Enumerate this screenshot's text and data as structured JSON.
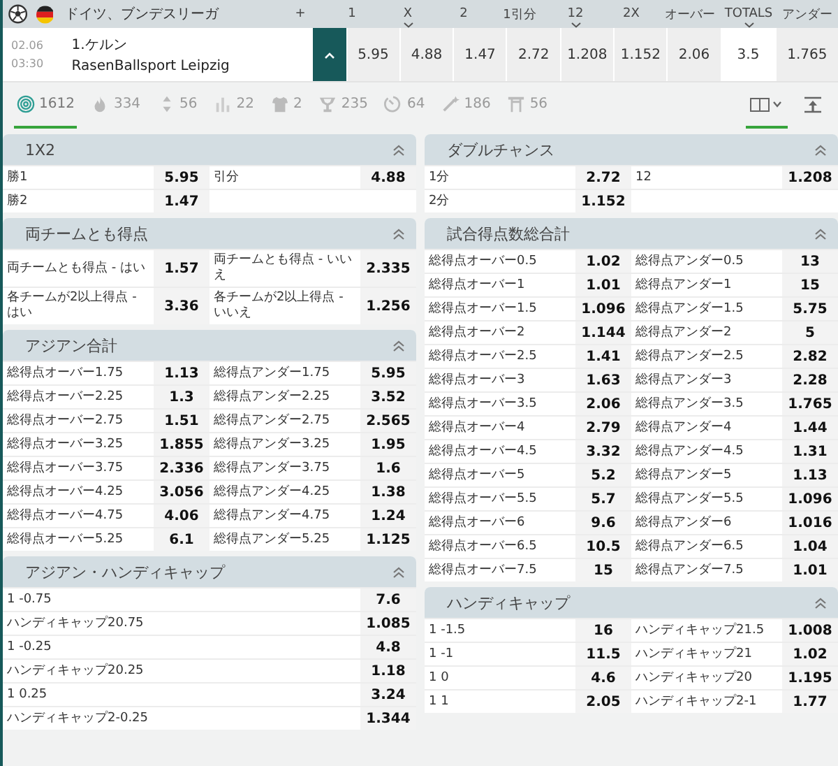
{
  "league": {
    "name": "ドイツ、ブンデスリーガ",
    "columns": [
      {
        "label": "+",
        "dropdown": false
      },
      {
        "label": "1",
        "dropdown": false
      },
      {
        "label": "X",
        "dropdown": true
      },
      {
        "label": "2",
        "dropdown": false
      },
      {
        "label": "1引分",
        "dropdown": false
      },
      {
        "label": "12",
        "dropdown": true
      },
      {
        "label": "2X",
        "dropdown": false
      },
      {
        "label": "オーバー",
        "dropdown": false
      },
      {
        "label": "TOTALS",
        "dropdown": true
      },
      {
        "label": "アンダー",
        "dropdown": false
      }
    ]
  },
  "match": {
    "date": "02.06",
    "time": "03:30",
    "home": "1.ケルン",
    "away": "RasenBallsport Leipzig",
    "expanded": true,
    "odds": [
      {
        "value": "5.95",
        "kind": "odd"
      },
      {
        "value": "4.88",
        "kind": "odd"
      },
      {
        "value": "1.47",
        "kind": "odd"
      },
      {
        "value": "2.72",
        "kind": "odd"
      },
      {
        "value": "1.208",
        "kind": "odd"
      },
      {
        "value": "1.152",
        "kind": "odd"
      },
      {
        "value": "2.06",
        "kind": "odd"
      },
      {
        "value": "3.5",
        "kind": "line"
      },
      {
        "value": "1.765",
        "kind": "odd"
      }
    ]
  },
  "filters": [
    {
      "kind": "all",
      "count": "1612",
      "selected": true
    },
    {
      "kind": "fire",
      "count": "334",
      "selected": false
    },
    {
      "kind": "updown",
      "count": "56",
      "selected": false
    },
    {
      "kind": "bars",
      "count": "22",
      "selected": false
    },
    {
      "kind": "shirt",
      "count": "2",
      "selected": false
    },
    {
      "kind": "trophy",
      "count": "235",
      "selected": false
    },
    {
      "kind": "timer",
      "count": "64",
      "selected": false
    },
    {
      "kind": "wand",
      "count": "186",
      "selected": false
    },
    {
      "kind": "gate",
      "count": "56",
      "selected": false
    }
  ],
  "view_buttons": [
    {
      "kind": "columns",
      "selected": true
    },
    {
      "kind": "collapse",
      "selected": false
    }
  ],
  "columns": [
    [
      {
        "title": "1X2",
        "expanded": true,
        "kind": "pairs",
        "rows": [
          [
            {
              "label": "勝1",
              "odd": "5.95"
            },
            {
              "label": "引分",
              "odd": "4.88"
            }
          ],
          [
            {
              "label": "勝2",
              "odd": "1.47"
            }
          ]
        ]
      },
      {
        "title": "両チームとも得点",
        "expanded": true,
        "kind": "pairs",
        "rows": [
          [
            {
              "label": "両チームとも得点 - はい",
              "odd": "1.57"
            },
            {
              "label": "両チームとも得点 - いいえ",
              "odd": "2.335"
            }
          ],
          [
            {
              "label": "各チームが2以上得点 - はい",
              "odd": "3.36"
            },
            {
              "label": "各チームが2以上得点 - いいえ",
              "odd": "1.256"
            }
          ]
        ]
      },
      {
        "title": "アジアン合計",
        "expanded": true,
        "kind": "pairs",
        "rows": [
          [
            {
              "label": "総得点オーバー1.75",
              "odd": "1.13"
            },
            {
              "label": "総得点アンダー1.75",
              "odd": "5.95"
            }
          ],
          [
            {
              "label": "総得点オーバー2.25",
              "odd": "1.3"
            },
            {
              "label": "総得点アンダー2.25",
              "odd": "3.52"
            }
          ],
          [
            {
              "label": "総得点オーバー2.75",
              "odd": "1.51"
            },
            {
              "label": "総得点アンダー2.75",
              "odd": "2.565"
            }
          ],
          [
            {
              "label": "総得点オーバー3.25",
              "odd": "1.855"
            },
            {
              "label": "総得点アンダー3.25",
              "odd": "1.95"
            }
          ],
          [
            {
              "label": "総得点オーバー3.75",
              "odd": "2.336"
            },
            {
              "label": "総得点アンダー3.75",
              "odd": "1.6"
            }
          ],
          [
            {
              "label": "総得点オーバー4.25",
              "odd": "3.056"
            },
            {
              "label": "総得点アンダー4.25",
              "odd": "1.38"
            }
          ],
          [
            {
              "label": "総得点オーバー4.75",
              "odd": "4.06"
            },
            {
              "label": "総得点アンダー4.75",
              "odd": "1.24"
            }
          ],
          [
            {
              "label": "総得点オーバー5.25",
              "odd": "6.1"
            },
            {
              "label": "総得点アンダー5.25",
              "odd": "1.125"
            }
          ]
        ]
      },
      {
        "title": "アジアン・ハンディキャップ",
        "expanded": true,
        "kind": "single",
        "rows": [
          [
            {
              "label": "1 -0.75",
              "odd": "7.6"
            }
          ],
          [
            {
              "label": "ハンディキャップ20.75",
              "odd": "1.085"
            }
          ],
          [
            {
              "label": "1 -0.25",
              "odd": "4.8"
            }
          ],
          [
            {
              "label": "ハンディキャップ20.25",
              "odd": "1.18"
            }
          ],
          [
            {
              "label": "1 0.25",
              "odd": "3.24"
            }
          ],
          [
            {
              "label": "ハンディキャップ2-0.25",
              "odd": "1.344"
            }
          ]
        ]
      }
    ],
    [
      {
        "title": "ダブルチャンス",
        "expanded": true,
        "kind": "pairs",
        "rows": [
          [
            {
              "label": "1分",
              "odd": "2.72"
            },
            {
              "label": "12",
              "odd": "1.208"
            }
          ],
          [
            {
              "label": "2分",
              "odd": "1.152"
            }
          ]
        ]
      },
      {
        "title": "試合得点数総合計",
        "expanded": true,
        "kind": "pairs",
        "rows": [
          [
            {
              "label": "総得点オーバー0.5",
              "odd": "1.02"
            },
            {
              "label": "総得点アンダー0.5",
              "odd": "13"
            }
          ],
          [
            {
              "label": "総得点オーバー1",
              "odd": "1.01"
            },
            {
              "label": "総得点アンダー1",
              "odd": "15"
            }
          ],
          [
            {
              "label": "総得点オーバー1.5",
              "odd": "1.096"
            },
            {
              "label": "総得点アンダー1.5",
              "odd": "5.75"
            }
          ],
          [
            {
              "label": "総得点オーバー2",
              "odd": "1.144"
            },
            {
              "label": "総得点アンダー2",
              "odd": "5"
            }
          ],
          [
            {
              "label": "総得点オーバー2.5",
              "odd": "1.41"
            },
            {
              "label": "総得点アンダー2.5",
              "odd": "2.82"
            }
          ],
          [
            {
              "label": "総得点オーバー3",
              "odd": "1.63"
            },
            {
              "label": "総得点アンダー3",
              "odd": "2.28"
            }
          ],
          [
            {
              "label": "総得点オーバー3.5",
              "odd": "2.06"
            },
            {
              "label": "総得点アンダー3.5",
              "odd": "1.765"
            }
          ],
          [
            {
              "label": "総得点オーバー4",
              "odd": "2.79"
            },
            {
              "label": "総得点アンダー4",
              "odd": "1.44"
            }
          ],
          [
            {
              "label": "総得点オーバー4.5",
              "odd": "3.32"
            },
            {
              "label": "総得点アンダー4.5",
              "odd": "1.31"
            }
          ],
          [
            {
              "label": "総得点オーバー5",
              "odd": "5.2"
            },
            {
              "label": "総得点アンダー5",
              "odd": "1.13"
            }
          ],
          [
            {
              "label": "総得点オーバー5.5",
              "odd": "5.7"
            },
            {
              "label": "総得点アンダー5.5",
              "odd": "1.096"
            }
          ],
          [
            {
              "label": "総得点オーバー6",
              "odd": "9.6"
            },
            {
              "label": "総得点アンダー6",
              "odd": "1.016"
            }
          ],
          [
            {
              "label": "総得点オーバー6.5",
              "odd": "10.5"
            },
            {
              "label": "総得点アンダー6.5",
              "odd": "1.04"
            }
          ],
          [
            {
              "label": "総得点オーバー7.5",
              "odd": "15"
            },
            {
              "label": "総得点アンダー7.5",
              "odd": "1.01"
            }
          ]
        ]
      },
      {
        "title": "ハンディキャップ",
        "expanded": true,
        "kind": "pairs",
        "rows": [
          [
            {
              "label": "1 -1.5",
              "odd": "16"
            },
            {
              "label": "ハンディキャップ21.5",
              "odd": "1.008"
            }
          ],
          [
            {
              "label": "1 -1",
              "odd": "11.5"
            },
            {
              "label": "ハンディキャップ21",
              "odd": "1.02"
            }
          ],
          [
            {
              "label": "1 0",
              "odd": "4.6"
            },
            {
              "label": "ハンディキャップ20",
              "odd": "1.195"
            }
          ],
          [
            {
              "label": "1 1",
              "odd": "2.05"
            },
            {
              "label": "ハンディキャップ2-1",
              "odd": "1.77"
            }
          ]
        ]
      }
    ]
  ]
}
